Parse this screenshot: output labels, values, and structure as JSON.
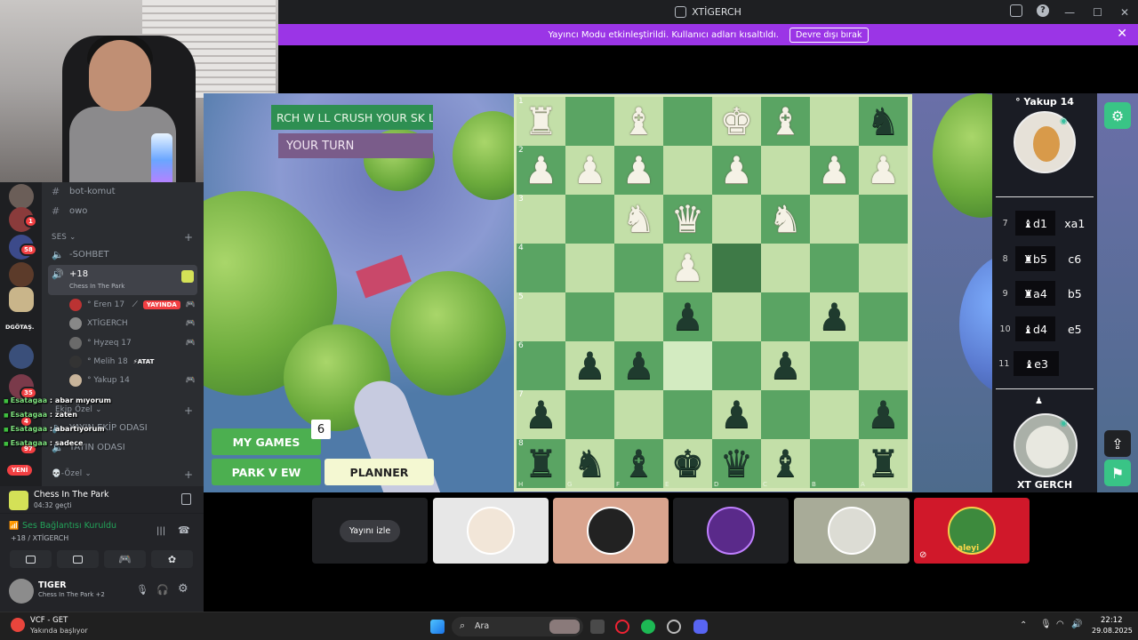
{
  "window": {
    "title": "XTİGERCH"
  },
  "notice": {
    "text": "Yayıncı Modu etkinleştirildi. Kullanıcı adları kısaltıldı.",
    "button": "Devre dışı bırak"
  },
  "sidebar": {
    "guild_badges": [
      "1",
      "58",
      "35",
      "4",
      "97"
    ],
    "guild_label": "DGÖTAŞ.",
    "new_badge": "YENİ",
    "channels": {
      "bot_komut": "bot-komut",
      "owo": "owo"
    },
    "section_ses": "SES",
    "sohbet": "-SOHBET",
    "voice_channel": {
      "name": "+18",
      "activity": "Chess In The Park"
    },
    "voice_users": [
      {
        "name": "° Eren 17",
        "badge": "YAYINDA"
      },
      {
        "name": "XTİGERCH"
      },
      {
        "name": "° Hyzeq 17"
      },
      {
        "name": "° Melih 18",
        "badge": "ATAT"
      },
      {
        "name": "° Yakup 14"
      }
    ],
    "ekip": "Ekip Özel",
    "yayin_ekip": "YAYIN EKİP ODASI",
    "yayin": "YAYIN ODASI",
    "ozel": "-Özel"
  },
  "chat_overlay": [
    {
      "user": "Esatagaa",
      "msg": "abar mıyorum"
    },
    {
      "user": "Esatagaa",
      "msg": "zaten"
    },
    {
      "user": "Esatagaa",
      "msg": "abartıyorum"
    },
    {
      "user": "Esatagaa",
      "msg": "sadece"
    }
  ],
  "activity": {
    "name": "Chess In The Park",
    "time": "04:32 geçti"
  },
  "voice_status": {
    "title": "Ses Bağlantısı Kuruldu",
    "channel": "+18 / XTİGERCH"
  },
  "user": {
    "name": "TIGER",
    "status": "Chess In The Park +2"
  },
  "game": {
    "scroll_text": "RCH W LL CRUSH YOUR SK LL",
    "turn_text": "YOUR TURN",
    "my_games": "MY GAMES",
    "my_games_count": "6",
    "park_view": "PARK V EW",
    "planner": "PLANNER",
    "ranks": [
      "1",
      "2",
      "3",
      "4",
      "5",
      "6",
      "7",
      "8"
    ],
    "files": [
      "H",
      "G",
      "F",
      "E",
      "D",
      "C",
      "B",
      "A"
    ],
    "board": [
      [
        "wR",
        "",
        "wB",
        "",
        "wK",
        "wB",
        "",
        "bN"
      ],
      [
        "wP",
        "wP",
        "wP",
        "",
        "wP",
        "",
        "wP",
        "wP"
      ],
      [
        "",
        "",
        "wN",
        "wQ",
        "",
        "wN",
        "",
        ""
      ],
      [
        "",
        "",
        "",
        "wP",
        "sel",
        "",
        "",
        ""
      ],
      [
        "",
        "",
        "",
        "bP",
        "",
        "",
        "bP",
        ""
      ],
      [
        "",
        "bP",
        "bP",
        "hl",
        "",
        "bP",
        "",
        ""
      ],
      [
        "bP",
        "",
        "",
        "",
        "bP",
        "",
        "",
        "bP"
      ],
      [
        "bR",
        "bN",
        "bB",
        "bK",
        "bQ",
        "bB",
        "",
        "bR"
      ]
    ]
  },
  "right_panel": {
    "top_player": "° Yakup 14",
    "bottom_player": "XT GERCH",
    "moves": [
      {
        "n": "7",
        "w": "♝d1",
        "b": "xa1"
      },
      {
        "n": "8",
        "w": "♜b5",
        "b": "c6"
      },
      {
        "n": "9",
        "w": "♜a4",
        "b": "b5"
      },
      {
        "n": "10",
        "w": "♝d4",
        "b": "e5"
      },
      {
        "n": "11",
        "w": "♝e3",
        "b": ""
      }
    ]
  },
  "tiles": {
    "watch_label": "Yayını izle",
    "name5": "aleyi"
  },
  "taskbar": {
    "np_title": "VCF - GET",
    "np_sub": "Yakında başlıyor",
    "search": "Ara",
    "time": "22:12",
    "date": "29.08.2025"
  },
  "colors": {
    "accent": "#9b35e6",
    "board_light": "#c3dfa8",
    "board_dark": "#5aa463",
    "turn": "#7a5c8a",
    "scroll": "#2e8f52"
  }
}
